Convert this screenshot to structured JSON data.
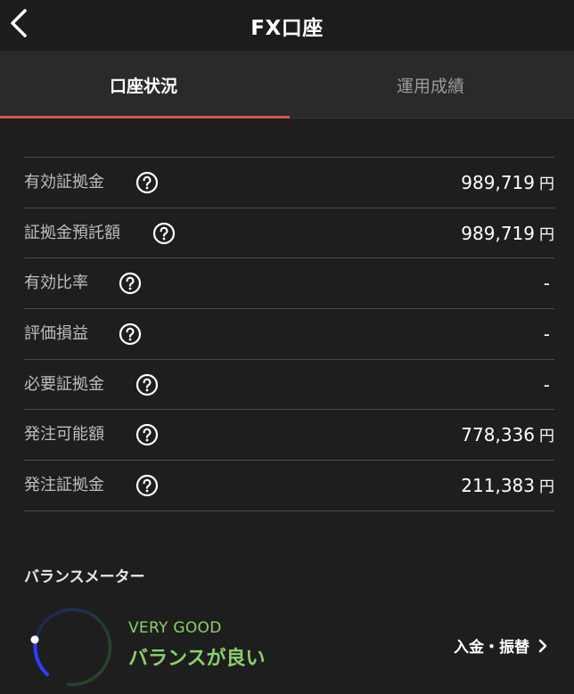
{
  "header": {
    "title": "FX口座",
    "back_icon": "chevron-left-icon"
  },
  "tabs": [
    {
      "label": "口座状況",
      "active": true
    },
    {
      "label": "運用成績",
      "active": false
    }
  ],
  "colors": {
    "accent": "#d94f55",
    "good": "#8ccf6a",
    "gauge_blue": "#2f3dff",
    "background": "#1e1e1e"
  },
  "rows": [
    {
      "label": "有効証拠金",
      "value": "989,719",
      "unit": "円"
    },
    {
      "label": "証拠金預託額",
      "value": "989,719",
      "unit": "円"
    },
    {
      "label": "有効比率",
      "value": "-",
      "unit": ""
    },
    {
      "label": "評価損益",
      "value": "-",
      "unit": ""
    },
    {
      "label": "必要証拠金",
      "value": "-",
      "unit": ""
    },
    {
      "label": "発注可能額",
      "value": "778,336",
      "unit": "円"
    },
    {
      "label": "発注証拠金",
      "value": "211,383",
      "unit": "円"
    }
  ],
  "balance": {
    "title": "バランスメーター",
    "rating_en": "VERY GOOD",
    "rating_jp": "バランスが良い"
  },
  "deposit": {
    "label": "入金・振替",
    "icon": "chevron-right-icon"
  }
}
